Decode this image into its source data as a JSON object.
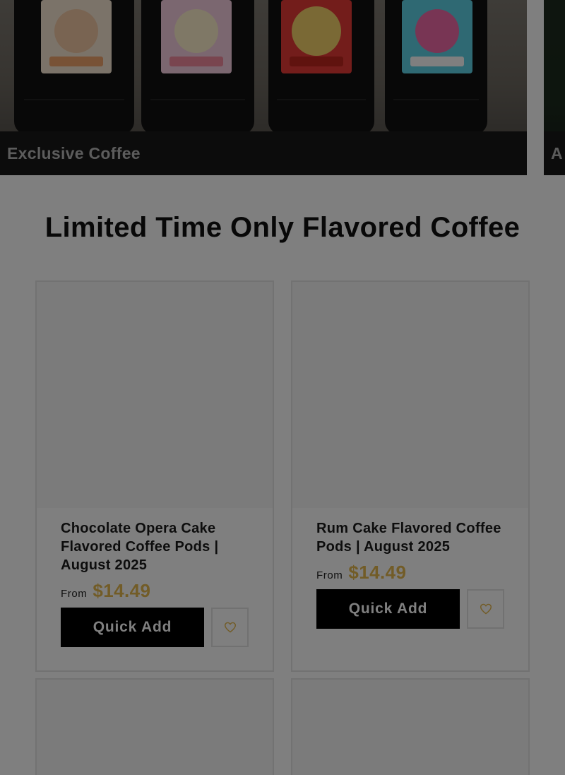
{
  "hero": {
    "cards": [
      {
        "caption": "Exclusive Coffee"
      },
      {
        "caption": "A"
      }
    ],
    "bag_colors": [
      "#f3c9a5",
      "#f38a9f",
      "#e63a36",
      "#4fd0e0"
    ]
  },
  "section": {
    "title": "Limited Time Only Flavored Coffee"
  },
  "products": [
    {
      "title": "Chocolate Opera Cake Flavored Coffee Pods | August 2025",
      "price_prefix": "From",
      "price": "$14.49",
      "quick_add_label": "Quick Add",
      "wishlist_icon": "heart-icon"
    },
    {
      "title": "Rum Cake Flavored Coffee Pods | August 2025",
      "price_prefix": "From",
      "price": "$14.49",
      "quick_add_label": "Quick Add",
      "wishlist_icon": "heart-icon"
    }
  ],
  "colors": {
    "price": "#e5b84f",
    "button": "#000000",
    "overlay": "rgba(0,0,0,0.5)"
  }
}
